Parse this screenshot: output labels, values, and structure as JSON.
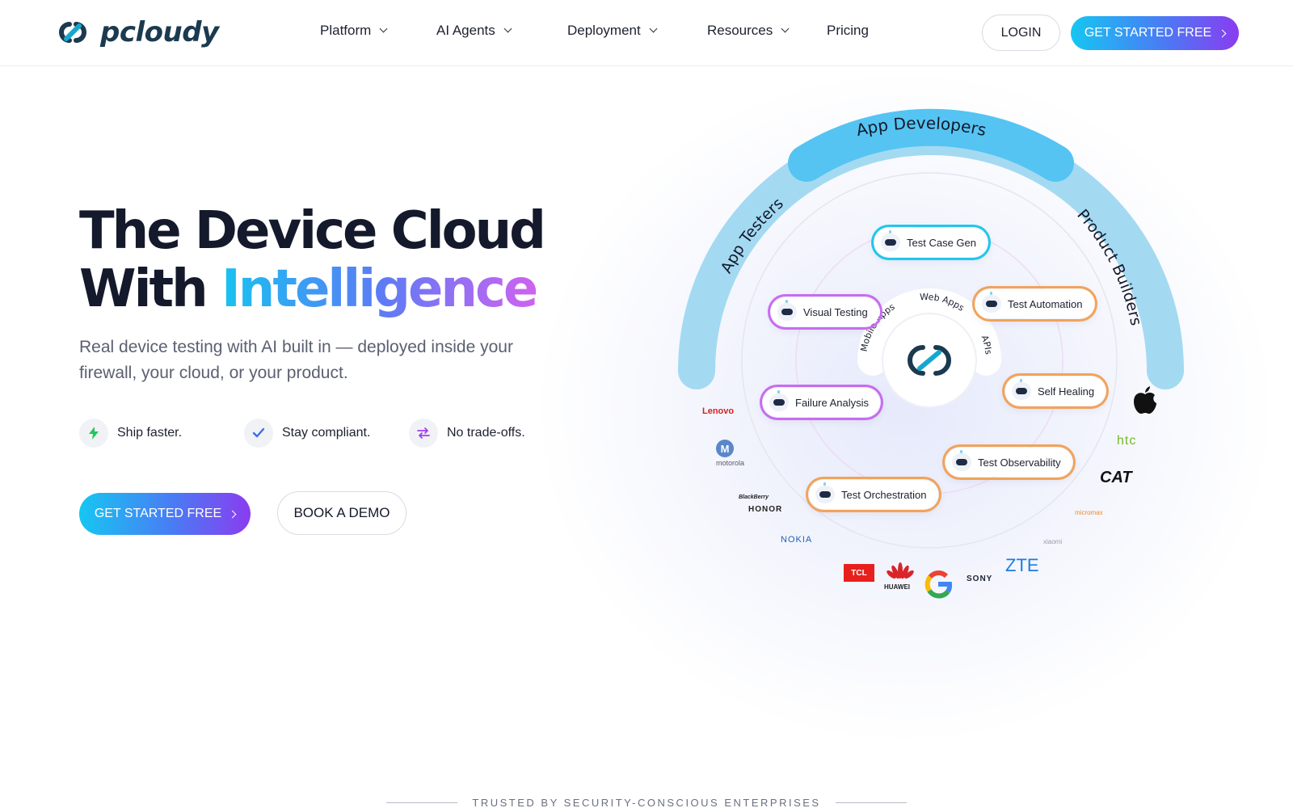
{
  "brand": {
    "name": "pcloudy"
  },
  "nav": {
    "items": [
      {
        "label": "Platform",
        "dropdown": true
      },
      {
        "label": "AI Agents",
        "dropdown": true
      },
      {
        "label": "Deployment",
        "dropdown": true
      },
      {
        "label": "Resources",
        "dropdown": true
      },
      {
        "label": "Pricing",
        "dropdown": false
      }
    ],
    "login": "LOGIN",
    "cta": "GET STARTED FREE"
  },
  "hero": {
    "title_line1": "The Device Cloud",
    "title_line2_prefix": "With ",
    "title_line2_highlight": "Intelligence",
    "subtitle": "Real device testing with AI built in — deployed inside your firewall, your cloud, or your product.",
    "features": [
      {
        "label": "Ship faster.",
        "icon": "lightning-icon",
        "color": "#22c55e"
      },
      {
        "label": "Stay compliant.",
        "icon": "checkmark-icon",
        "color": "#3b6fe8"
      },
      {
        "label": "No trade-offs.",
        "icon": "swap-arrows-icon",
        "color": "#a23ff0"
      }
    ],
    "cta_primary": "GET STARTED FREE",
    "cta_secondary": "BOOK A DEMO"
  },
  "diagram": {
    "audiences": {
      "top": "App Developers",
      "left": "App Testers",
      "right": "Product Builders"
    },
    "inner_ring": [
      "Mobile Apps",
      "Web Apps",
      "APIs"
    ],
    "agents": [
      "Test Case Gen",
      "Visual Testing",
      "Test Automation",
      "Failure Analysis",
      "Self Healing",
      "Test Observability",
      "Test Orchestration"
    ],
    "device_brands": [
      "Lenovo",
      "motorola",
      "BlackBerry",
      "HONOR",
      "NOKIA",
      "TCL",
      "HUAWEI",
      "SONY",
      "ZTE",
      "xiaomi",
      "micromax",
      "CAT",
      "htc"
    ],
    "colors": {
      "arc": "#7fd3f3",
      "arc_highlight": "#4cc3f2",
      "accent_start": "#16c6f2",
      "accent_end": "#8a3cf0"
    }
  },
  "footer": {
    "trusted_label": "TRUSTED BY SECURITY-CONSCIOUS ENTERPRISES"
  }
}
